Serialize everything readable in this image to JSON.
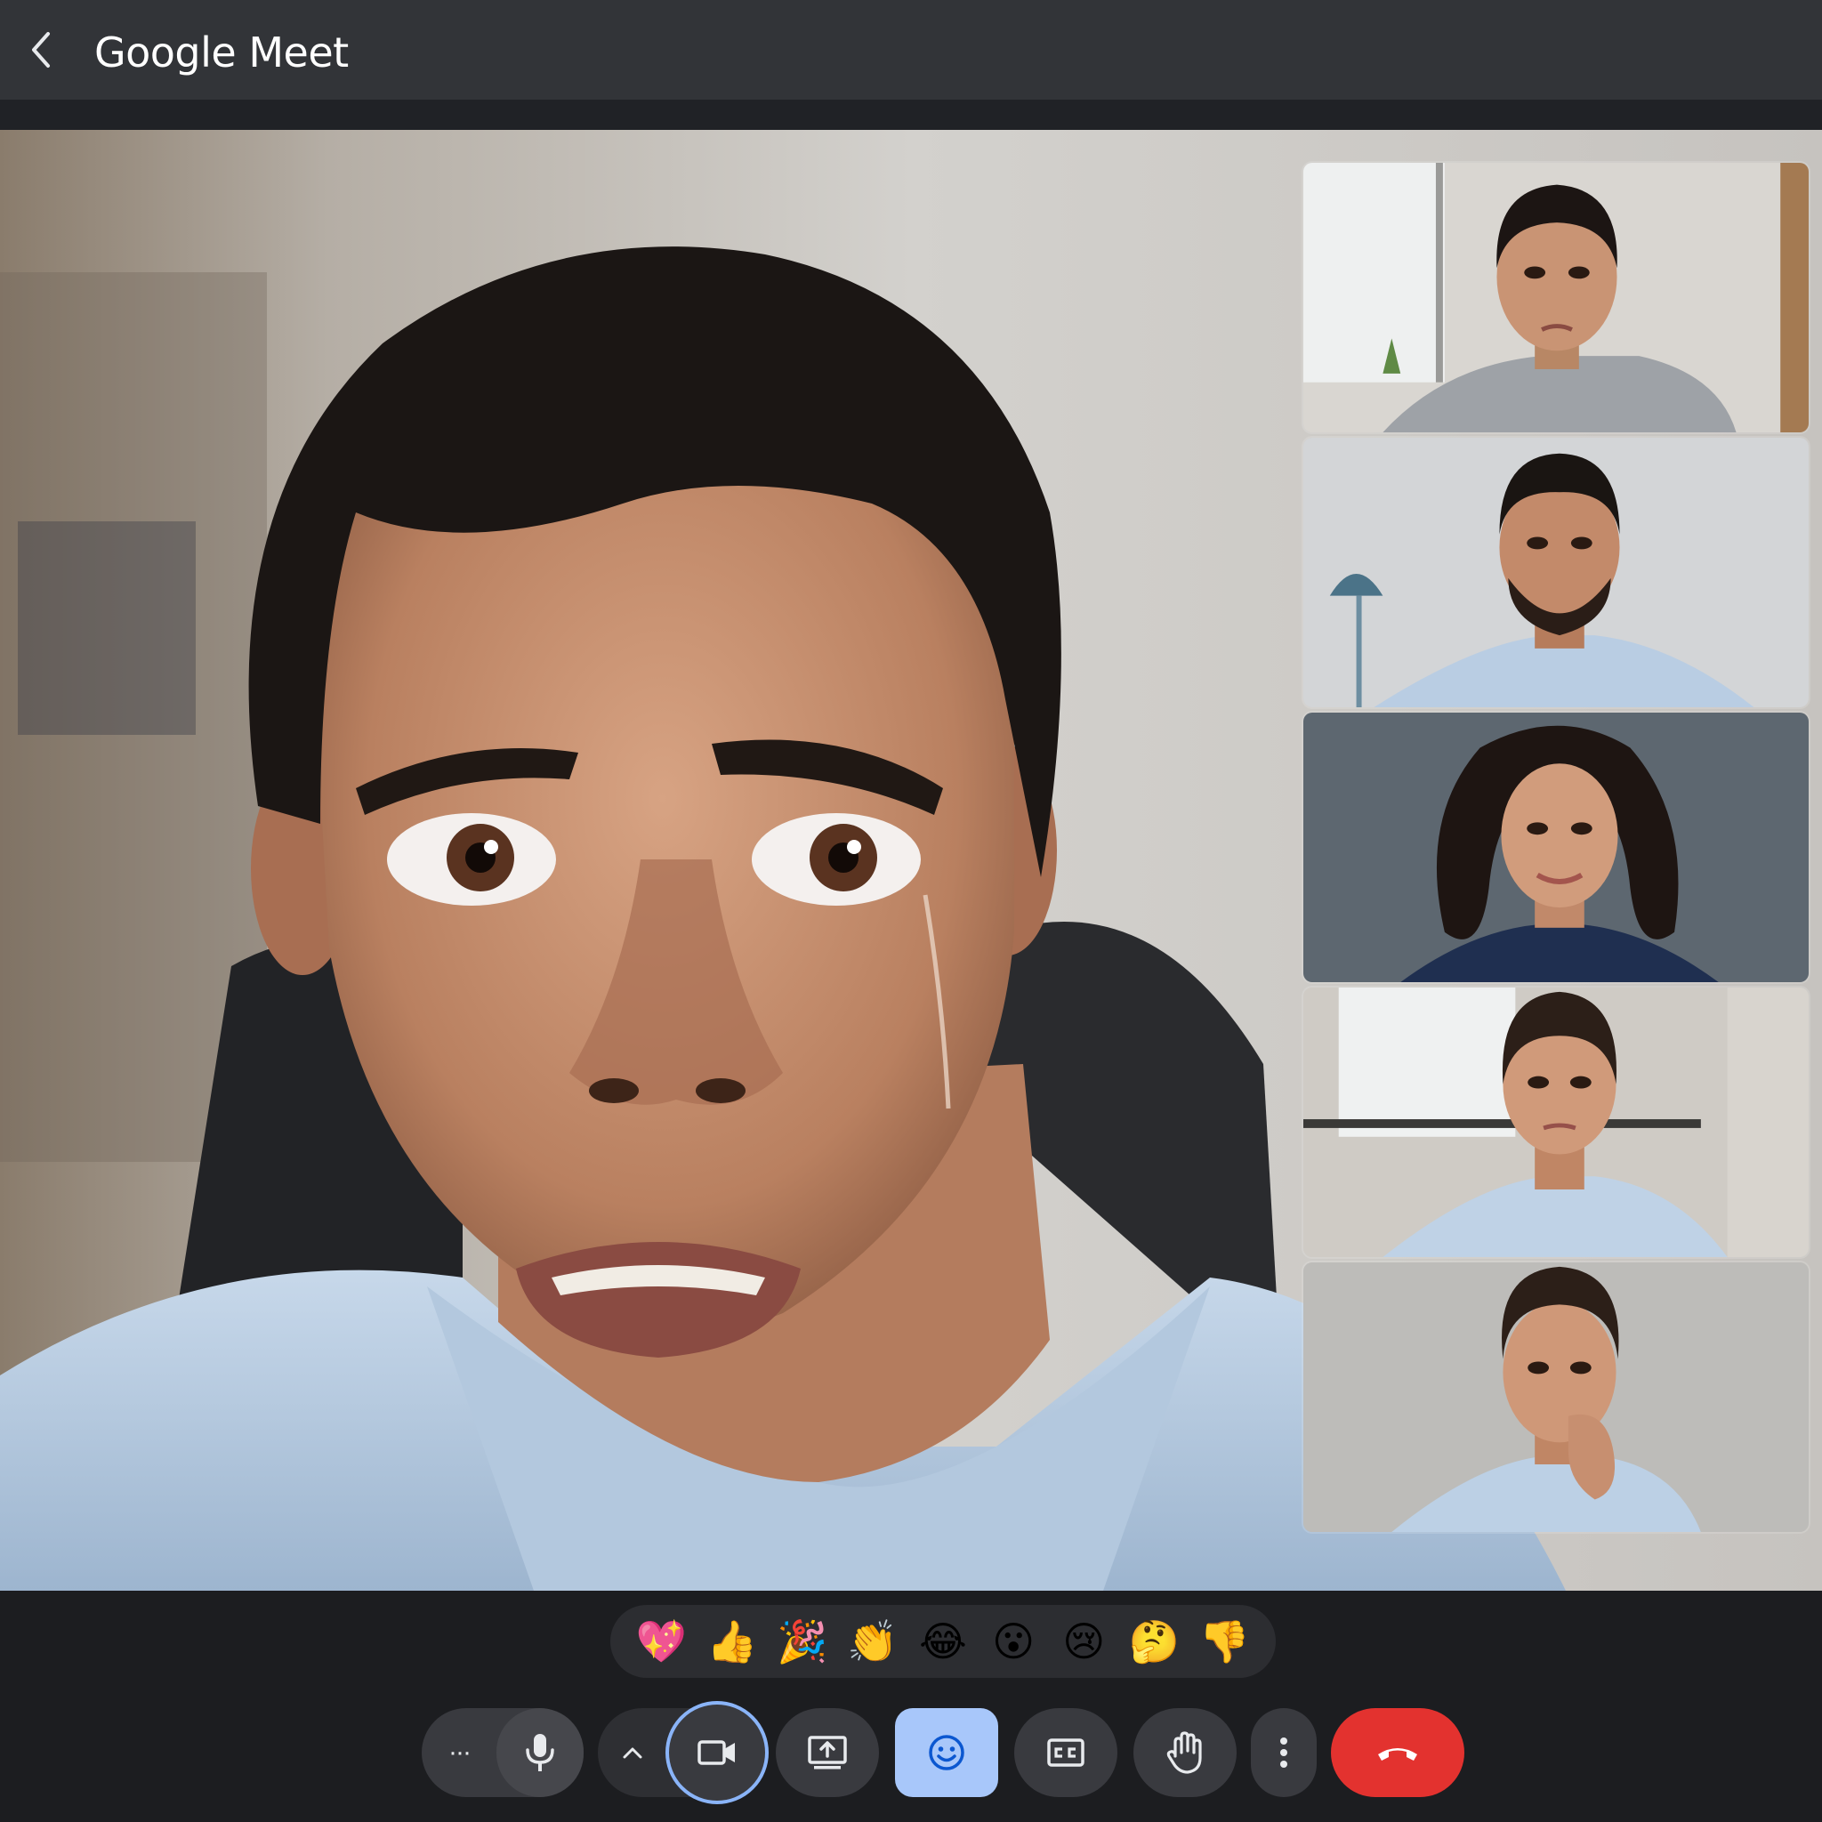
{
  "header": {
    "app_title": "Google Meet",
    "back_icon": "chevron-left-icon"
  },
  "participants": {
    "main": {
      "description_icon": "video-feed",
      "colors": {
        "background": "#c9c6c1",
        "shirt": "#b9cde3"
      }
    },
    "tiles": [
      {
        "id": "tile-1"
      },
      {
        "id": "tile-2"
      },
      {
        "id": "tile-3"
      },
      {
        "id": "tile-4"
      },
      {
        "id": "tile-5"
      }
    ]
  },
  "reactions": [
    {
      "emoji": "💖",
      "icon": "sparkling-heart-icon"
    },
    {
      "emoji": "👍",
      "icon": "thumbs-up-icon"
    },
    {
      "emoji": "🎉",
      "icon": "party-popper-icon"
    },
    {
      "emoji": "👏",
      "icon": "clapping-hands-icon"
    },
    {
      "emoji": "😂",
      "icon": "tears-of-joy-icon"
    },
    {
      "emoji": "😮",
      "icon": "open-mouth-icon"
    },
    {
      "emoji": "😢",
      "icon": "crying-face-icon"
    },
    {
      "emoji": "🤔",
      "icon": "thinking-face-icon"
    },
    {
      "emoji": "👎",
      "icon": "thumbs-down-icon"
    }
  ],
  "controls": {
    "more_options": "···",
    "colors": {
      "end_call": "#e3322f",
      "active_emoji": "#a8c7fa",
      "camera_ring": "#8ab4f8",
      "button": "#393a3f"
    }
  }
}
